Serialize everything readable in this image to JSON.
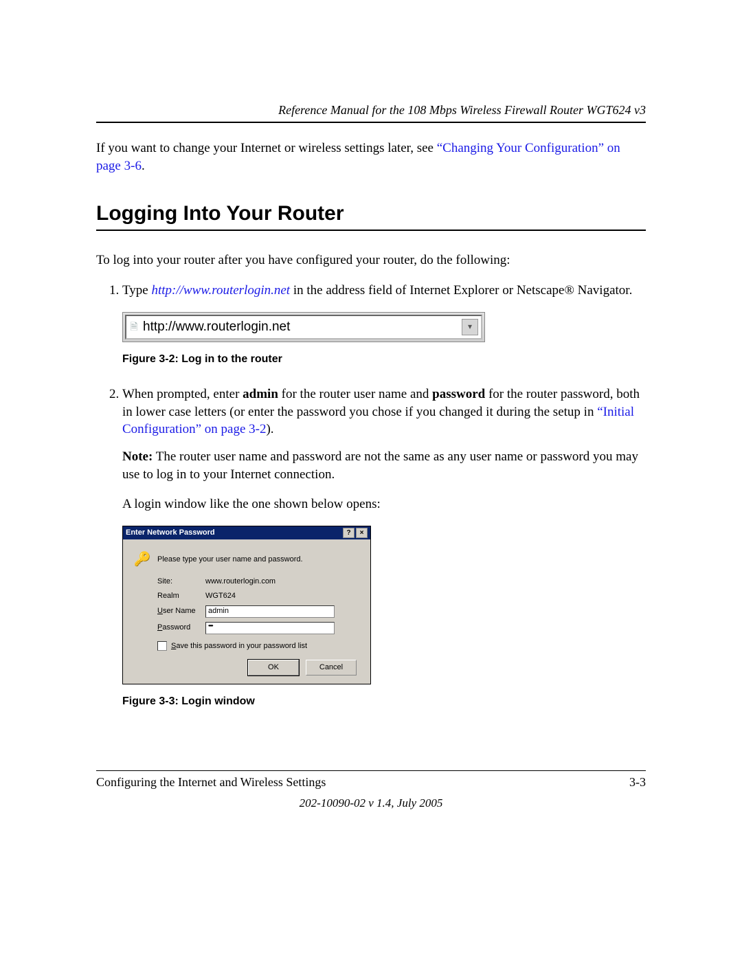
{
  "header": {
    "running_title": "Reference Manual for the 108 Mbps Wireless Firewall Router WGT624 v3"
  },
  "intro": {
    "text_before_link": "If you want to change your Internet or wireless settings later, see ",
    "link_text": "“Changing Your Configuration” on page 3-6",
    "text_after_link": "."
  },
  "section_heading": "Logging Into Your Router",
  "lead_para": "To log into your router after you have configured your router, do the following:",
  "step1": {
    "before_url": "Type ",
    "url": "http://www.routerlogin.net",
    "after_url": " in the address field of Internet Explorer or Netscape® Navigator."
  },
  "addressbar": {
    "text": "http://www.routerlogin.net"
  },
  "fig1_caption": "Figure 3-2:  Log in to the router",
  "step2": {
    "p1_a": "When prompted, enter ",
    "p1_b_bold": "admin",
    "p1_c": " for the router user name and ",
    "p1_d_bold": "password",
    "p1_e": " for the router password, both in lower case letters (or enter the password you chose if you changed it during the setup in ",
    "p1_link": "“Initial Configuration” on page 3-2",
    "p1_f": ").",
    "note_label": "Note:",
    "note_text": " The router user name and password are not the same as any user name or password you may use to log in to your Internet connection.",
    "p3": "A login window like the one shown below opens:"
  },
  "dialog": {
    "title": "Enter Network Password",
    "help_btn": "?",
    "close_btn": "×",
    "message": "Please type your user name and password.",
    "site_label_pre": "S",
    "site_label_rest": "ite:",
    "site_value": "www.routerlogin.com",
    "realm_label": "Realm",
    "realm_value": "WGT624",
    "user_label_u": "U",
    "user_label_rest": "ser Name",
    "user_value": "admin",
    "pass_label_p": "P",
    "pass_label_rest": "assword",
    "pass_value": "•••••••",
    "save_label_s": "S",
    "save_label_rest": "ave this password in your password list",
    "ok": "OK",
    "cancel": "Cancel"
  },
  "fig2_caption": "Figure 3-3:  Login window",
  "footer": {
    "chapter": "Configuring the Internet and Wireless Settings",
    "page": "3-3",
    "version": "202-10090-02 v 1.4, July 2005"
  }
}
